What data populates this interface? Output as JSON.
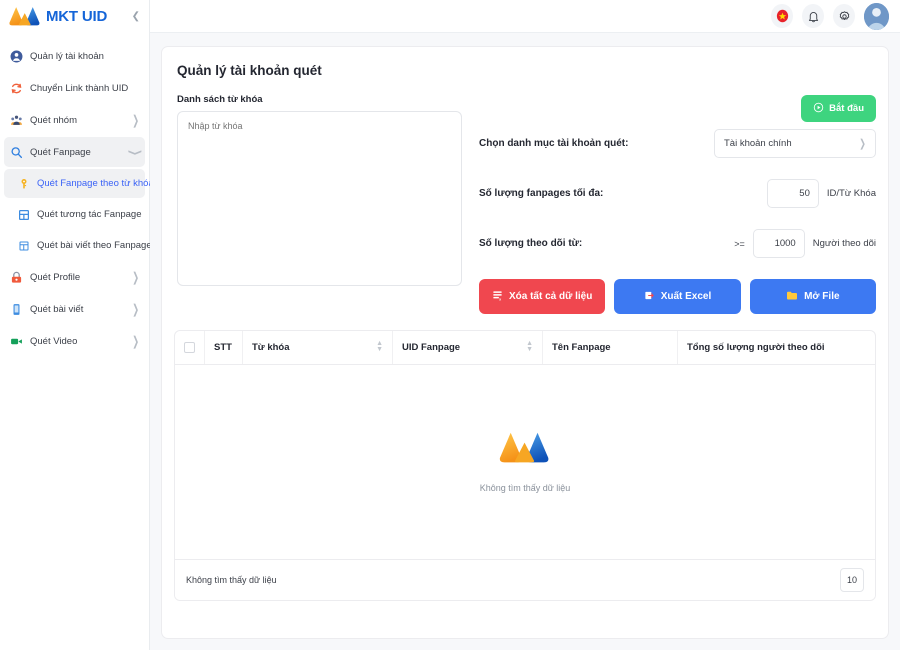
{
  "brand": {
    "name": "MKT UID",
    "collapse_icon": "chevron-left-icon"
  },
  "sidebar": {
    "items": [
      {
        "label": "Quản lý tài khoản",
        "icon": "user-circle-icon",
        "has_chevron": false,
        "active": false
      },
      {
        "label": "Chuyển Link thành UID",
        "icon": "refresh-icon",
        "has_chevron": false,
        "active": false
      },
      {
        "label": "Quét nhóm",
        "icon": "group-icon",
        "has_chevron": true,
        "active": false
      },
      {
        "label": "Quét Fanpage",
        "icon": "magnifier-icon",
        "has_chevron": true,
        "active": true,
        "expanded": true
      }
    ],
    "sub_items": [
      {
        "label": "Quét Fanpage theo từ khóa",
        "icon": "key-icon",
        "active": true
      },
      {
        "label": "Quét tương tác Fanpage",
        "icon": "interaction-icon",
        "active": false
      },
      {
        "label": "Quét bài viết theo Fanpage",
        "icon": "article-icon",
        "active": false
      }
    ],
    "items_after": [
      {
        "label": "Quét Profile",
        "icon": "lock-icon",
        "has_chevron": true
      },
      {
        "label": "Quét bài viết",
        "icon": "document-icon",
        "has_chevron": true
      },
      {
        "label": "Quét Video",
        "icon": "video-camera-icon",
        "has_chevron": true
      }
    ]
  },
  "topbar": {
    "language_icon": "vietnam-flag-icon",
    "notification_icon": "bell-icon",
    "settings_icon": "gear-icon",
    "avatar_icon": "user-avatar-icon"
  },
  "page": {
    "title": "Quản lý tài khoản quét",
    "keyword_list_label": "Danh sách từ khóa",
    "keyword_placeholder": "Nhập từ khóa",
    "keyword_value": "",
    "start_button": "Bắt đầu",
    "start_icon": "play-circle-icon"
  },
  "fields": {
    "category_label": "Chọn danh mục tài khoản quét:",
    "category_value": "Tài khoản chính",
    "max_fanpages_label": "Số lượng fanpages tối đa:",
    "max_fanpages_value": "50",
    "max_fanpages_unit": "ID/Từ Khóa",
    "followers_label": "Số lượng theo dõi từ:",
    "followers_operator": ">=",
    "followers_value": "1000",
    "followers_unit": "Người theo dõi"
  },
  "buttons": [
    {
      "label": "Xóa tất cả dữ liệu",
      "icon": "delete-list-icon",
      "style": "danger"
    },
    {
      "label": "Xuất Excel",
      "icon": "export-icon",
      "style": "primary"
    },
    {
      "label": "Mở File",
      "icon": "folder-icon",
      "style": "primary"
    }
  ],
  "table": {
    "columns": [
      {
        "label": "",
        "type": "checkbox"
      },
      {
        "label": "STT",
        "sortable": false
      },
      {
        "label": "Từ khóa",
        "sortable": true
      },
      {
        "label": "UID Fanpage",
        "sortable": true
      },
      {
        "label": "Tên Fanpage",
        "sortable": false
      },
      {
        "label": "Tổng số lượng người theo dõi",
        "sortable": false
      }
    ],
    "rows": [],
    "empty_text": "Không tìm thấy dữ liệu",
    "empty_logo": "mkt-logo-icon",
    "footer_text": "Không tìm thấy dữ liệu",
    "page_size": "10"
  },
  "colors": {
    "brand_blue": "#1565d8",
    "logo_orange": "#f5a623",
    "logo_blue": "#1565d8",
    "accent_green": "#3ed47f",
    "accent_red": "#f0474f",
    "accent_primary": "#3d79f2",
    "active_link": "#3b63f6",
    "page_bg": "#f7f8fa"
  }
}
